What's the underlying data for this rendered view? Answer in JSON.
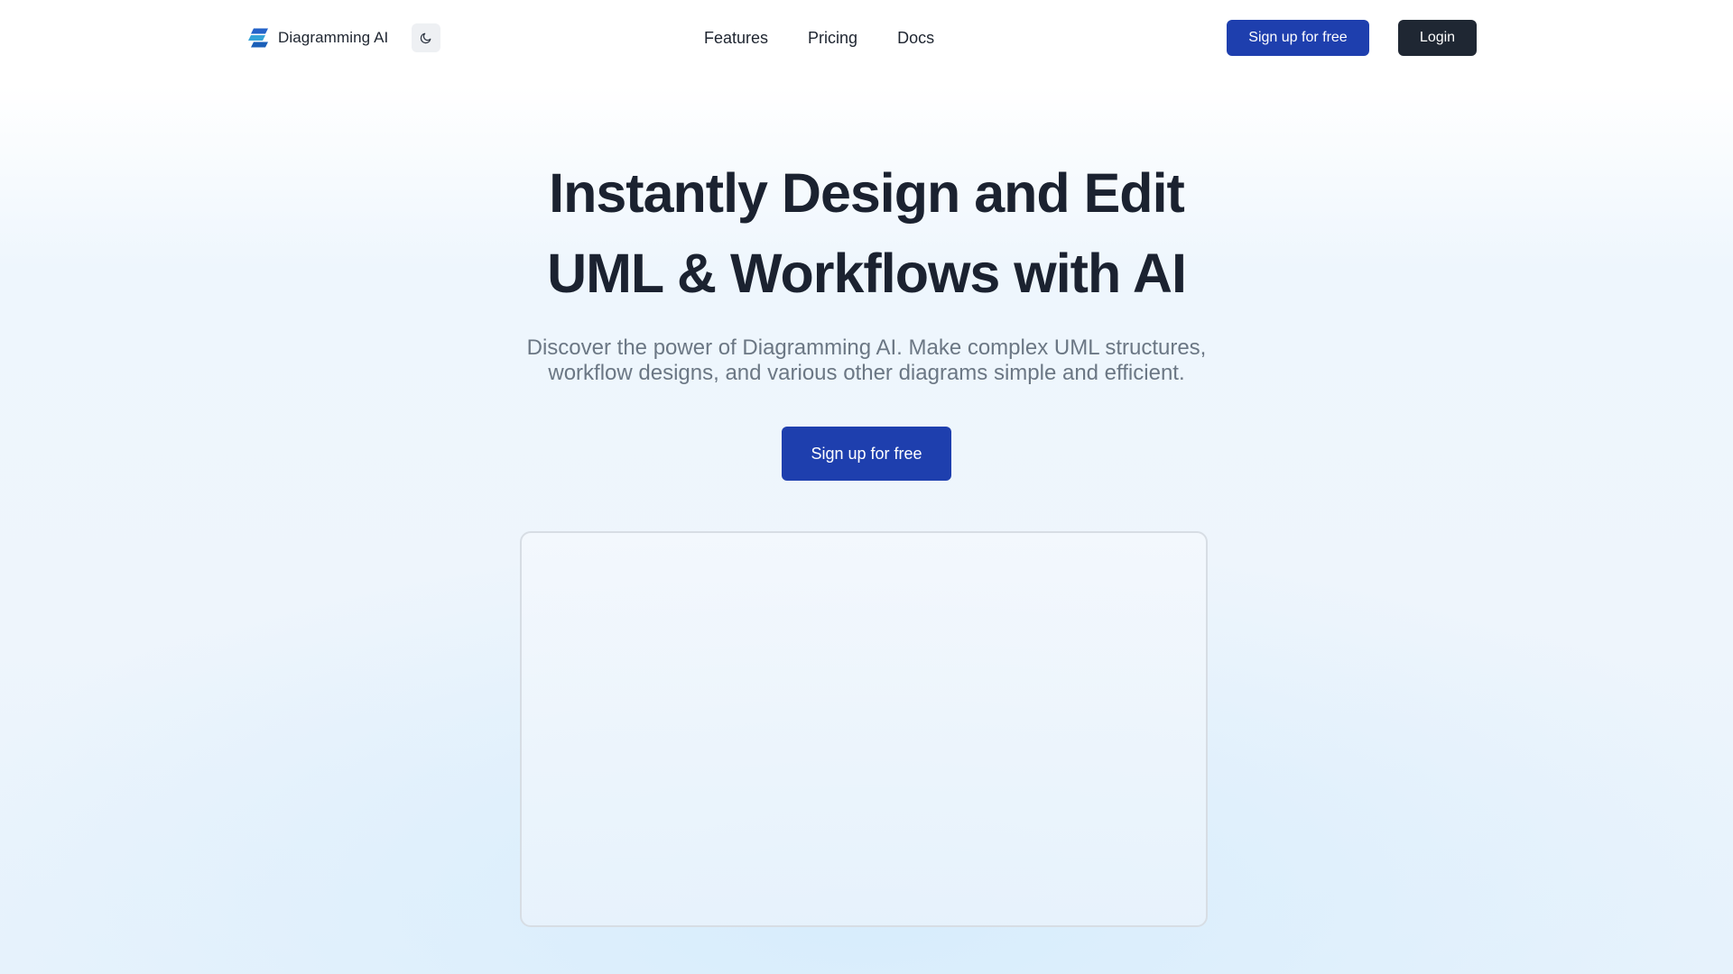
{
  "header": {
    "brand": {
      "name": "Diagramming AI",
      "logo_icon": "stacked-layers-logo-icon",
      "logo_colors": [
        "#2563c9",
        "#35a3d8",
        "#1a5fb8"
      ]
    },
    "theme_toggle_icon": "moon-icon",
    "nav": [
      {
        "label": "Features"
      },
      {
        "label": "Pricing"
      },
      {
        "label": "Docs"
      }
    ],
    "signup_label": "Sign up for free",
    "login_label": "Login"
  },
  "hero": {
    "title_lines": [
      "Instantly Design and Edit",
      "UML & Workflows with AI"
    ],
    "subtitle_lines": [
      "Discover the power of Diagramming AI. Make complex UML structures,",
      "workflow designs, and various other diagrams simple and efficient."
    ],
    "cta_label": "Sign up for free"
  },
  "colors": {
    "primary": "#1e3fae",
    "dark_button": "#1f2733",
    "heading": "#1b2230",
    "muted_text": "#6b7784"
  }
}
